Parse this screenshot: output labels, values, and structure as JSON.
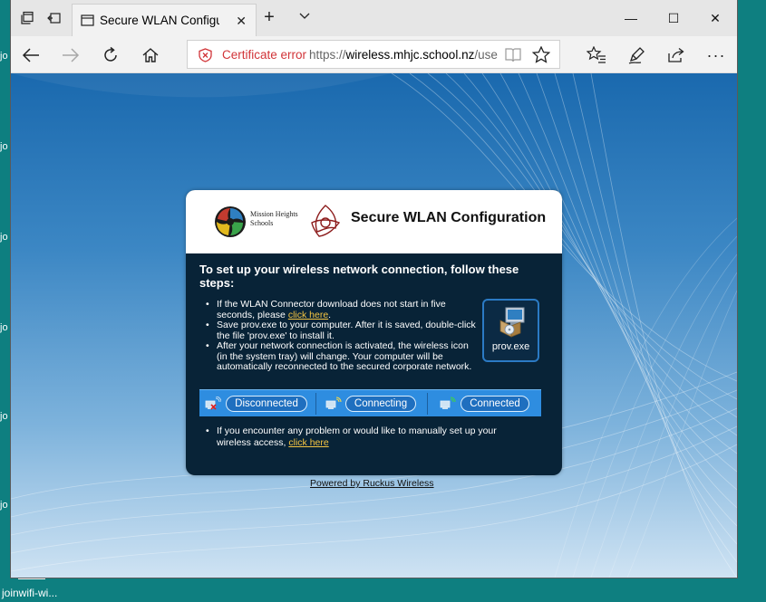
{
  "desktop": {
    "side_labels": [
      "jo",
      "jo",
      "jo",
      "jo",
      "jo",
      "jo",
      "jo"
    ],
    "file_label": "joinwifi-wi..."
  },
  "browser": {
    "tab_title": "Secure WLAN Configura",
    "tab_close": "✕",
    "new_tab": "+",
    "window_controls": {
      "minimize": "—",
      "maximize": "☐",
      "close": "✕"
    },
    "address_bar": {
      "certificate_error": "Certificate error",
      "url_scheme": "https://",
      "url_host": "wireless.mhjc.school.nz",
      "url_path": "/user,"
    },
    "more_menu": "···"
  },
  "card": {
    "logo_line1": "Mission Heights",
    "logo_line2": "Schools",
    "title": "Secure WLAN Configuration",
    "steps_heading": "To set up your wireless network connection, follow these steps:",
    "step1_text": "If the WLAN Connector download does not start in five seconds, please ",
    "step1_link": "click here",
    "step1_end": ".",
    "step2_text": "Save prov.exe to your computer. After it is saved, double-click the file 'prov.exe' to install it.",
    "step3_text": "After your network connection is activated, the wireless icon (in the system tray) will change. Your computer will be automatically reconnected to the secured corporate network.",
    "prov_label": "prov.exe",
    "statuses": {
      "disconnected": "Disconnected",
      "connecting": "Connecting",
      "connected": "Connected"
    },
    "help_text": "If you encounter any problem or would like to manually set up your wireless access, ",
    "help_link": "click here"
  },
  "footer": {
    "powered_by": "Powered by Ruckus Wireless"
  },
  "colors": {
    "desktop": "#0e7f80",
    "card_body": "#082337",
    "status_bar": "#2e8de0",
    "link": "#f5c542",
    "certificate_error": "#d13438"
  }
}
